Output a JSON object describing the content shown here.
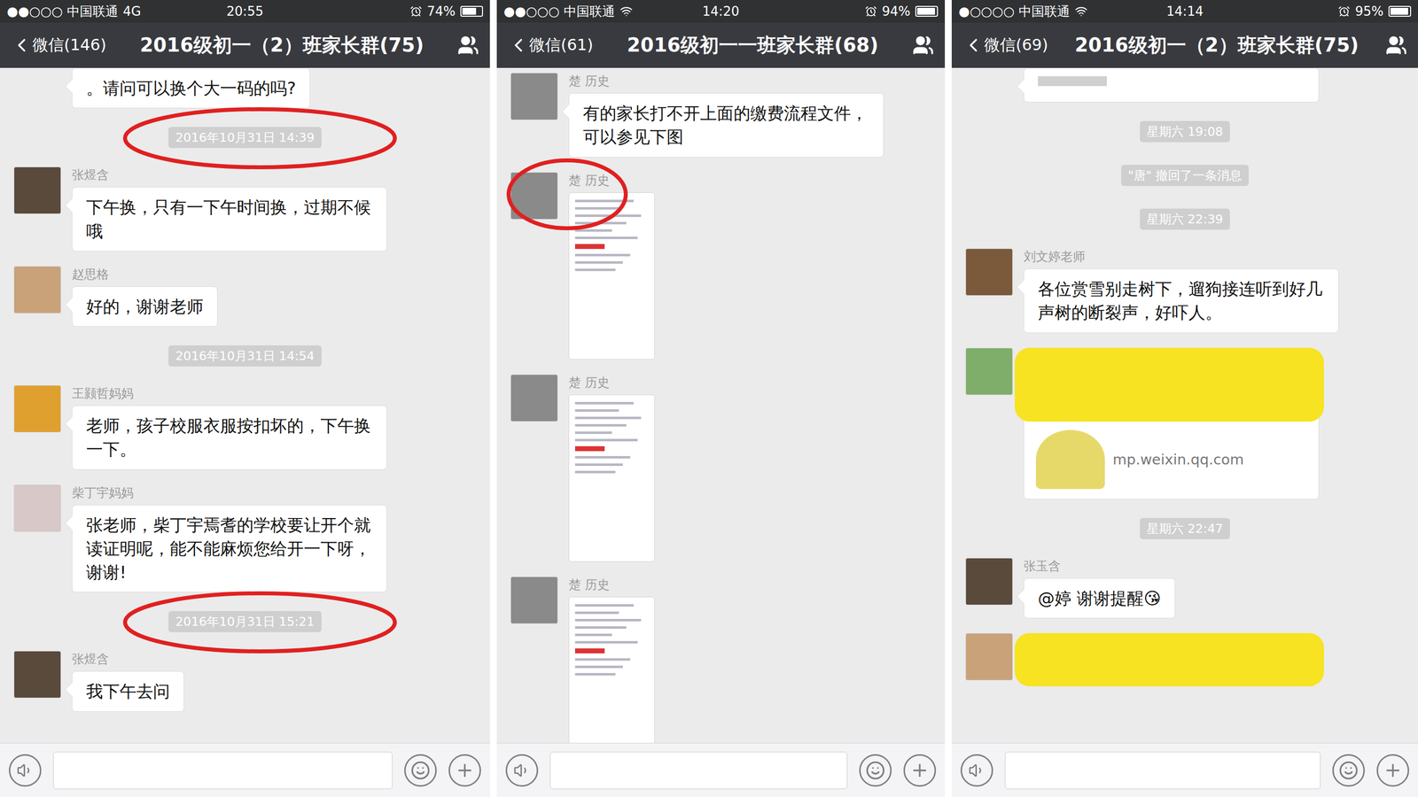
{
  "panels": [
    {
      "status_bar": {
        "carrier": "●●○○○ 中国联通",
        "network": "4G",
        "wifi": false,
        "time": "20:55",
        "battery": "74%",
        "battery_level": 0.74
      },
      "nav": {
        "back": "微信(146)",
        "title": "2016级初一（2）班家长群(75)"
      },
      "messages": [
        {
          "kind": "cut",
          "text": "。请问可以换个大一码的吗?"
        },
        {
          "kind": "time",
          "text": "2016年10月31日 14:39",
          "circled": true
        },
        {
          "kind": "text",
          "sender": "张煜含",
          "text": "下午换，只有一下午时间换，过期不候哦",
          "color": "#5a4a3c",
          "redacted": false,
          "circled": false
        },
        {
          "kind": "text",
          "sender": "赵思格",
          "text": "好的，谢谢老师",
          "color": "#c9a27a",
          "redacted": false,
          "circled": false
        },
        {
          "kind": "time",
          "text": "2016年10月31日 14:54",
          "circled": false
        },
        {
          "kind": "text",
          "sender": "王颢哲妈妈",
          "text": "老师，孩子校服衣服按扣坏的，下午换一下。",
          "color": "#e0a030",
          "redacted": false,
          "circled": false
        },
        {
          "kind": "text",
          "sender": "柴丁宇妈妈",
          "text": "张老师，柴丁宇焉耆的学校要让开个就读证明呢，能不能麻烦您给开一下呀，谢谢!",
          "color": "#d8c8c8",
          "redacted": false,
          "circled": false
        },
        {
          "kind": "time",
          "text": "2016年10月31日 15:21",
          "circled": true
        },
        {
          "kind": "text",
          "sender": "张煜含",
          "text": "我下午去问",
          "color": "#5a4a3c",
          "redacted": false,
          "circled": false
        }
      ]
    },
    {
      "status_bar": {
        "carrier": "●●○○○ 中国联通",
        "network": "",
        "wifi": true,
        "time": "14:20",
        "battery": "94%",
        "battery_level": 0.94
      },
      "nav": {
        "back": "微信(61)",
        "title": "2016级初一一班家长群(68)"
      },
      "messages": [
        {
          "kind": "text",
          "sender": "楚 历史",
          "text": "有的家长打不开上面的缴费流程文件，可以参见下图",
          "color": "#8a8a8a",
          "redacted": false,
          "circled": false
        },
        {
          "kind": "image",
          "sender": "楚 历史",
          "color": "#8a8a8a",
          "redacted": false,
          "circled": true
        },
        {
          "kind": "image",
          "sender": "楚 历史",
          "color": "#8a8a8a",
          "redacted": false,
          "circled": false
        },
        {
          "kind": "image",
          "sender": "楚 历史",
          "color": "#8a8a8a",
          "redacted": false,
          "circled": false
        }
      ]
    },
    {
      "status_bar": {
        "carrier": "●○○○○ 中国联通",
        "network": "",
        "wifi": true,
        "time": "14:14",
        "battery": "95%",
        "battery_level": 0.95
      },
      "nav": {
        "back": "微信(69)",
        "title": "2016级初一（2）班家长群(75)"
      },
      "messages": [
        {
          "kind": "cut",
          "text": ""
        },
        {
          "kind": "time",
          "text": "星期六 19:08",
          "circled": false
        },
        {
          "kind": "system",
          "text": "\"唐\" 撤回了一条消息"
        },
        {
          "kind": "time",
          "text": "星期六 22:39",
          "circled": false
        },
        {
          "kind": "text",
          "sender": "刘文婷老师",
          "text": "各位赏雪别走树下，遛狗接连听到好几声树的断裂声，好吓人。",
          "color": "#7a5a3a",
          "redacted": false,
          "circled": false
        },
        {
          "kind": "link",
          "sender": "",
          "source": "mp.weixin.qq.com",
          "color": "#7fae6a",
          "redacted": true,
          "circled": false
        },
        {
          "kind": "time",
          "text": "星期六 22:47",
          "circled": false
        },
        {
          "kind": "text",
          "sender": "张玉含",
          "text": "@婷 谢谢提醒😘",
          "color": "#5a4a3c",
          "redacted": false,
          "circled": false
        },
        {
          "kind": "text",
          "sender": "",
          "text": "",
          "color": "#c9a27a",
          "redacted": true,
          "circled": false
        }
      ]
    }
  ]
}
